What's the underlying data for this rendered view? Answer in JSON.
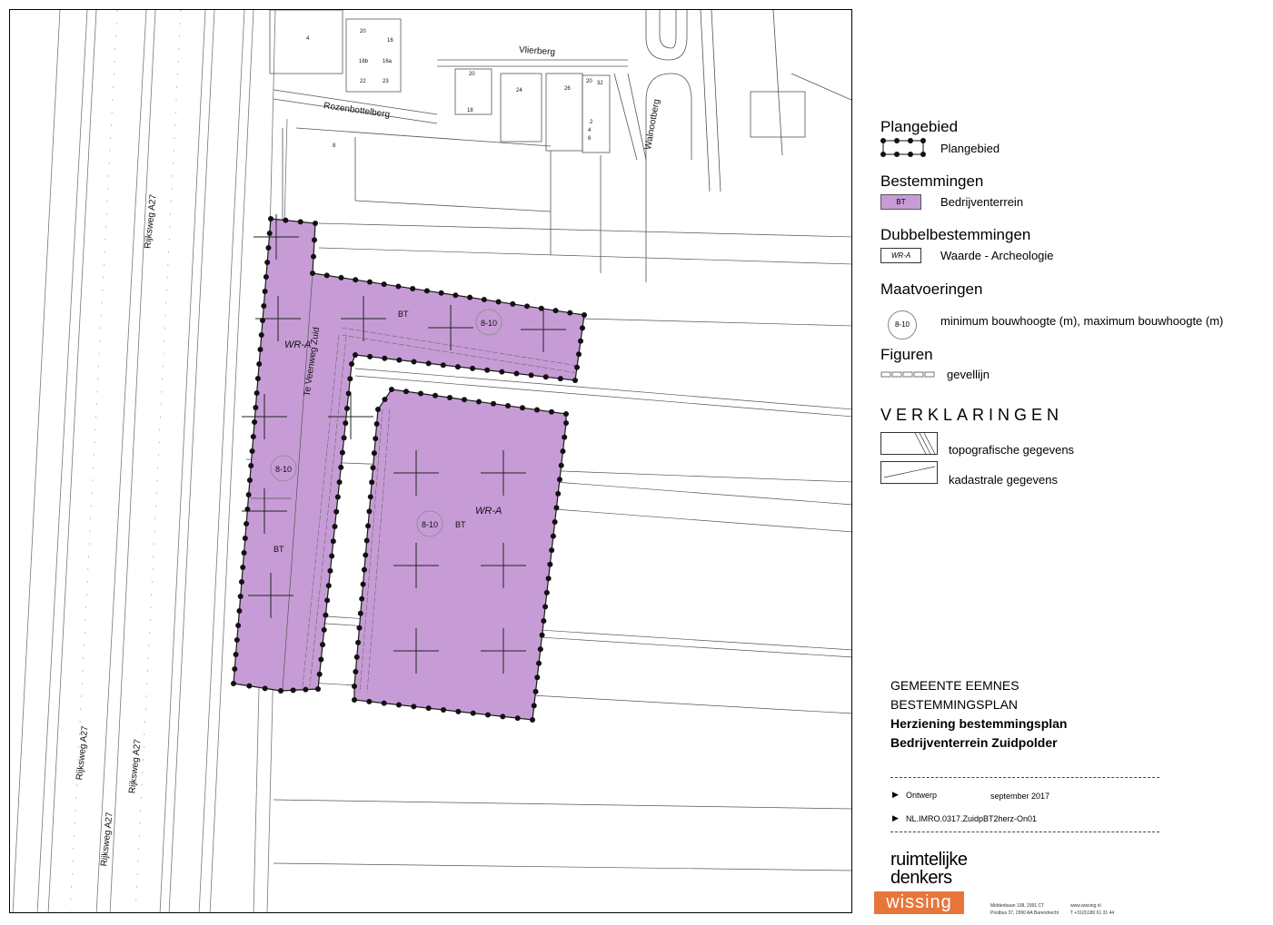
{
  "map": {
    "street_labels": [
      "Vlierberg",
      "Rozenbottelberg",
      "Walnootberg",
      "Te Veenweg Zuid"
    ],
    "highway_labels": [
      "Rijksweg A27",
      "Rijksweg A27",
      "Rijksweg A27",
      "Rijksweg A27"
    ],
    "house_numbers": [
      "4",
      "20",
      "16",
      "16b",
      "16a",
      "22",
      "23",
      "20",
      "24",
      "18",
      "26",
      "20",
      "32",
      "2",
      "4",
      "6",
      "8"
    ],
    "zone_labels": {
      "bt1": "BT",
      "bt2": "BT",
      "bt3": "BT",
      "wra1": "WR-A",
      "wra2": "WR-A"
    },
    "height_markers": [
      "8-10",
      "8-10",
      "8-10"
    ],
    "colors": {
      "zone_fill": "#c79cd6",
      "boundary": "#1a1a1a",
      "lines": "#555555"
    }
  },
  "legend": {
    "plangebied": {
      "heading": "Plangebied",
      "item": "Plangebied"
    },
    "bestemmingen": {
      "heading": "Bestemmingen",
      "code": "BT",
      "item": "Bedrijventerrein"
    },
    "dubbelbestemmingen": {
      "heading": "Dubbelbestemmingen",
      "code": "WR-A",
      "item": "Waarde - Archeologie"
    },
    "maatvoeringen": {
      "heading": "Maatvoeringen",
      "code": "8-10",
      "item": "minimum bouwhoogte (m), maximum bouwhoogte (m)"
    },
    "figuren": {
      "heading": "Figuren",
      "item": "gevellijn"
    },
    "verklaringen": {
      "heading": "VERKLARINGEN",
      "topo": "topografische gegevens",
      "kadaster": "kadastrale gegevens"
    }
  },
  "title_block": {
    "line1": "GEMEENTE EEMNES",
    "line2": "BESTEMMINGSPLAN",
    "line3": "Herziening bestemmingsplan",
    "line4": "Bedrijventerrein Zuidpolder",
    "status_label": "Ontwerp",
    "status_date": "september 2017",
    "plan_id": "NL.IMRO.0317.ZuidpBT2herz-On01"
  },
  "brand": {
    "logo_line1": "ruimtelijke",
    "logo_line2": "denkers",
    "logo_badge": "wissing",
    "address1": "Middenbaan 108, 2991 CT",
    "address2": "Postbus 37, 2990 AA Barendrecht",
    "web": "www.wissing.nl",
    "phone": "T +31(0)180 61 31 44",
    "badge_color": "#e8763a"
  }
}
